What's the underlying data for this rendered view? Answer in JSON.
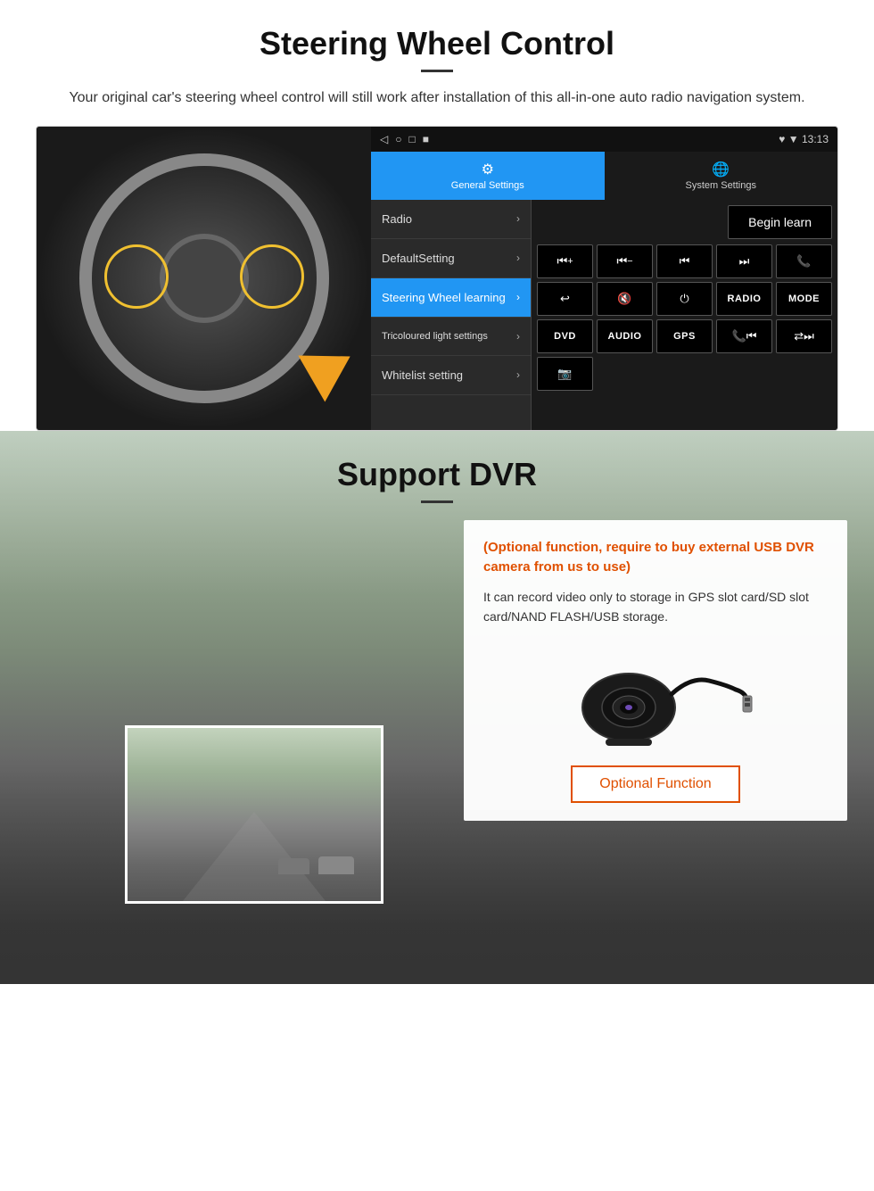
{
  "steering_section": {
    "title": "Steering Wheel Control",
    "description": "Your original car's steering wheel control will still work after installation of this all-in-one auto radio navigation system.",
    "statusbar": {
      "icons": [
        "◁",
        "○",
        "□",
        "■"
      ],
      "right": "♥ ▼ 13:13"
    },
    "tabs": [
      {
        "label": "General Settings",
        "icon": "⚙",
        "active": true
      },
      {
        "label": "System Settings",
        "icon": "🌐",
        "active": false
      }
    ],
    "menu_items": [
      {
        "label": "Radio",
        "active": false
      },
      {
        "label": "DefaultSetting",
        "active": false
      },
      {
        "label": "Steering Wheel learning",
        "active": true
      },
      {
        "label": "Tricoloured light settings",
        "active": false
      },
      {
        "label": "Whitelist setting",
        "active": false
      }
    ],
    "begin_learn_label": "Begin learn",
    "control_buttons": [
      "⏮+",
      "⏮−",
      "⏮⏮",
      "⏭⏭",
      "📞",
      "↩",
      "🔇×",
      "⏻",
      "RADIO",
      "MODE",
      "DVD",
      "AUDIO",
      "GPS",
      "📞⏮",
      "🔀⏭"
    ],
    "bottom_btn": "📷"
  },
  "dvr_section": {
    "title": "Support DVR",
    "optional_text": "(Optional function, require to buy external USB DVR camera from us to use)",
    "desc_text": "It can record video only to storage in GPS slot card/SD slot card/NAND FLASH/USB storage.",
    "optional_function_label": "Optional Function"
  }
}
